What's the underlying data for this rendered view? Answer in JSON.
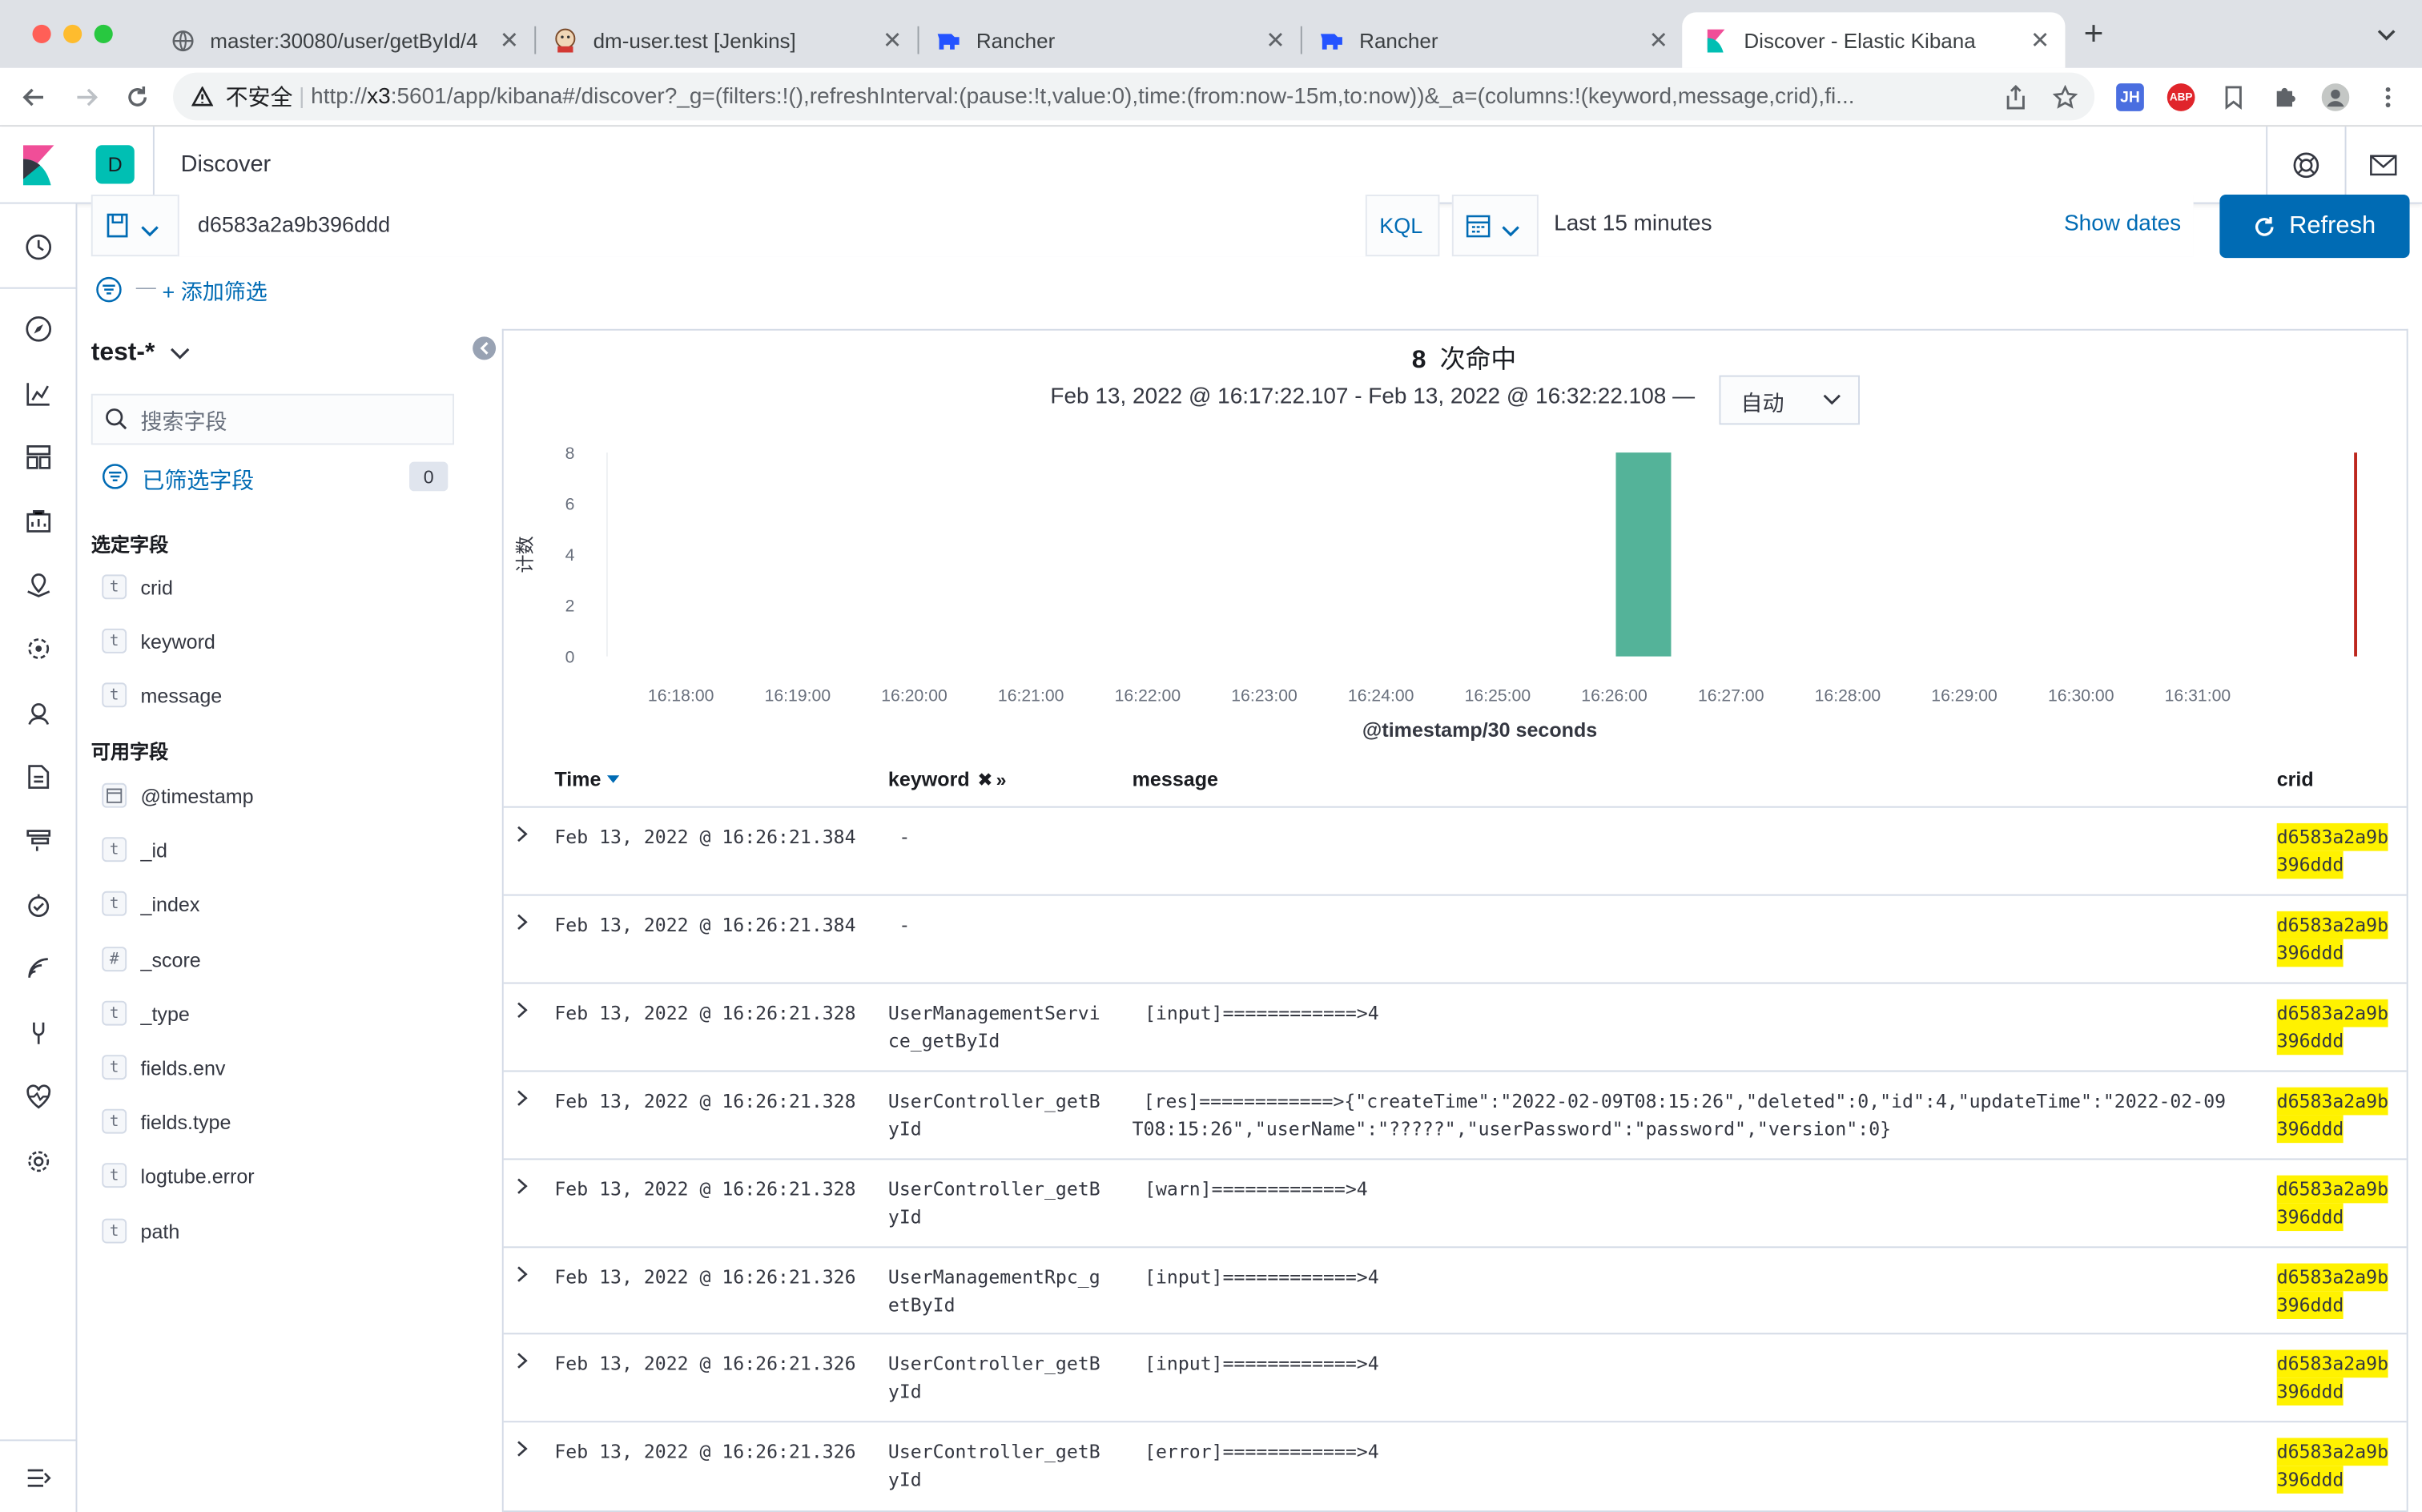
{
  "browser": {
    "tabs": [
      {
        "title": "master:30080/user/getById/4",
        "icon": "globe-icon"
      },
      {
        "title": "dm-user.test [Jenkins]",
        "icon": "jenkins-icon"
      },
      {
        "title": "Rancher",
        "icon": "rancher-icon"
      },
      {
        "title": "Rancher",
        "icon": "rancher-icon"
      },
      {
        "title": "Discover - Elastic Kibana",
        "icon": "kibana-icon"
      }
    ],
    "new_tab": "+",
    "security_label": "不安全",
    "url_host": "x3",
    "url_prefix": "http://",
    "url_rest": ":5601/app/kibana#/discover?_g=(filters:!(),refreshInterval:(pause:!t,value:0),time:(from:now-15m,to:now))&_a=(columns:!(keyword,message,crid),fi...",
    "ext_jh": "JH",
    "ext_abp": "ABP"
  },
  "kibana": {
    "space_letter": "D",
    "app_title": "Discover",
    "query": {
      "text": "d6583a2a9b396ddd",
      "language": "KQL",
      "time_range": "Last 15 minutes",
      "show_dates": "Show dates",
      "refresh": "Refresh",
      "add_filter": "+ 添加筛选",
      "dash": "—"
    },
    "sidebar": {
      "index_pattern": "test-*",
      "search_placeholder": "搜索字段",
      "filtered_label": "已筛选字段",
      "filtered_count": "0",
      "selected_heading": "选定字段",
      "selected_fields": [
        {
          "type": "t",
          "name": "crid"
        },
        {
          "type": "t",
          "name": "keyword"
        },
        {
          "type": "t",
          "name": "message"
        }
      ],
      "available_heading": "可用字段",
      "available_fields": [
        {
          "type": "cal",
          "name": "@timestamp"
        },
        {
          "type": "t",
          "name": "_id"
        },
        {
          "type": "t",
          "name": "_index"
        },
        {
          "type": "#",
          "name": "_score"
        },
        {
          "type": "t",
          "name": "_type"
        },
        {
          "type": "t",
          "name": "fields.env"
        },
        {
          "type": "t",
          "name": "fields.type"
        },
        {
          "type": "t",
          "name": "logtube.error"
        },
        {
          "type": "t",
          "name": "path"
        }
      ]
    },
    "hits": {
      "count": "8",
      "label": "次命中",
      "range": "Feb 13, 2022 @ 16:17:22.107 - Feb 13, 2022 @ 16:32:22.108 —",
      "interval": "自动"
    }
  },
  "chart_data": {
    "type": "bar",
    "ylabel": "计数",
    "xlabel": "@timestamp/30 seconds",
    "ylim": [
      0,
      8
    ],
    "yticks": [
      "0",
      "2",
      "4",
      "6",
      "8"
    ],
    "x_ticks": [
      "16:18:00",
      "16:19:00",
      "16:20:00",
      "16:21:00",
      "16:22:00",
      "16:23:00",
      "16:24:00",
      "16:25:00",
      "16:26:00",
      "16:27:00",
      "16:28:00",
      "16:29:00",
      "16:30:00",
      "16:31:00"
    ],
    "x_range": [
      "16:17:22",
      "16:32:22"
    ],
    "bars": [
      {
        "x": "16:26:00",
        "value": 8
      }
    ],
    "now_marker": "16:32:22",
    "bar_color": "#54b399",
    "marker_color": "#bd271e"
  },
  "table": {
    "headers": {
      "time": "Time",
      "keyword": "keyword",
      "message": "message",
      "crid": "crid"
    },
    "rows": [
      {
        "time": "Feb 13, 2022 @ 16:26:21.384",
        "keyword": [
          "-"
        ],
        "message": [
          ""
        ],
        "crid": [
          "d6583a2a9b",
          "396ddd"
        ]
      },
      {
        "time": "Feb 13, 2022 @ 16:26:21.384",
        "keyword": [
          "-"
        ],
        "message": [
          ""
        ],
        "crid": [
          "d6583a2a9b",
          "396ddd"
        ]
      },
      {
        "time": "Feb 13, 2022 @ 16:26:21.328",
        "keyword": [
          "UserManagementServi",
          "ce_getById"
        ],
        "message": [
          "[input]============>4"
        ],
        "crid": [
          "d6583a2a9b",
          "396ddd"
        ]
      },
      {
        "time": "Feb 13, 2022 @ 16:26:21.328",
        "keyword": [
          "UserController_getB",
          "yId"
        ],
        "message": [
          " [res]============>{\"createTime\":\"2022-02-09T08:15:26\",\"deleted\":0,\"id\":4,\"updateTime\":\"2022-02-09",
          "T08:15:26\",\"userName\":\"?????\",\"userPassword\":\"password\",\"version\":0}"
        ],
        "crid": [
          "d6583a2a9b",
          "396ddd"
        ]
      },
      {
        "time": "Feb 13, 2022 @ 16:26:21.328",
        "keyword": [
          "UserController_getB",
          "yId"
        ],
        "message": [
          "[warn]============>4"
        ],
        "crid": [
          "d6583a2a9b",
          "396ddd"
        ]
      },
      {
        "time": "Feb 13, 2022 @ 16:26:21.326",
        "keyword": [
          "UserManagementRpc_g",
          "etById"
        ],
        "message": [
          "[input]============>4"
        ],
        "crid": [
          "d6583a2a9b",
          "396ddd"
        ]
      },
      {
        "time": "Feb 13, 2022 @ 16:26:21.326",
        "keyword": [
          "UserController_getB",
          "yId"
        ],
        "message": [
          "[input]============>4"
        ],
        "crid": [
          "d6583a2a9b",
          "396ddd"
        ]
      },
      {
        "time": "Feb 13, 2022 @ 16:26:21.326",
        "keyword": [
          "UserController_getB",
          "yId"
        ],
        "message": [
          "[error]============>4"
        ],
        "crid": [
          "d6583a2a9b",
          "396ddd"
        ]
      }
    ]
  },
  "colors": {
    "accent": "#006bb4",
    "kibana_teal": "#00bfb3",
    "highlight": "#fff200"
  }
}
